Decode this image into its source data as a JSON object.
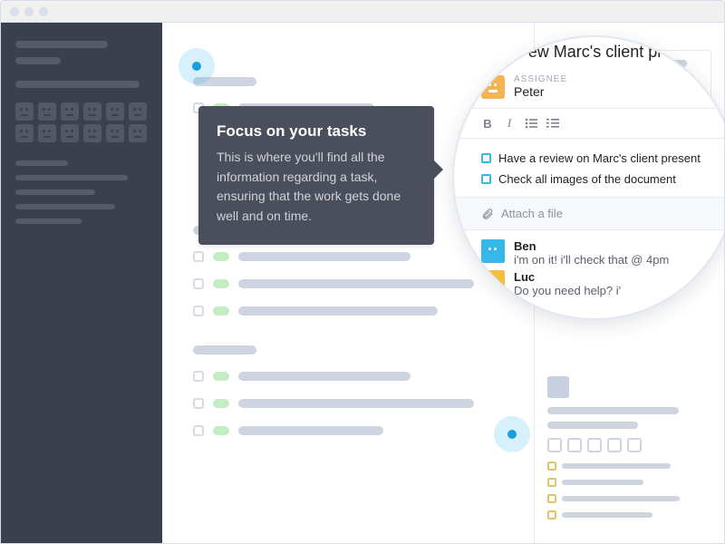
{
  "tooltip": {
    "title": "Focus on your tasks",
    "body": "This is where you'll find all the information regarding a task, ensuring that the work gets done well and on time."
  },
  "detail_zoom": {
    "title": "ew Marc's client pr",
    "assignee_label": "ASSIGNEE",
    "assignee_name": "Peter",
    "checklist": [
      "Have a review on Marc's client present",
      "Check all images of the document"
    ],
    "attach_label": "Attach a file",
    "comments": [
      {
        "author": "Ben",
        "text": "i'm on it! i'll check that @ 4pm",
        "color": "blue"
      },
      {
        "author": "Luc",
        "text": "Do you need help? i'",
        "color": "yellow"
      }
    ]
  },
  "icons": {
    "bold": "B",
    "italic": "I"
  }
}
